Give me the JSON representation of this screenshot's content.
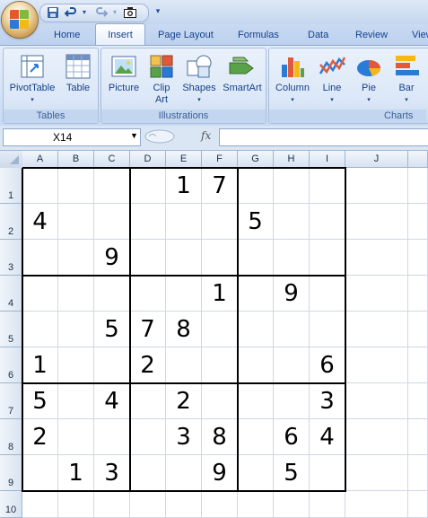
{
  "quick_access": {
    "undo_arrow": "▾",
    "redo_arrow": "▾",
    "customize_arrow": "▾"
  },
  "tabs": [
    {
      "label": "Home"
    },
    {
      "label": "Insert",
      "active": true
    },
    {
      "label": "Page Layout"
    },
    {
      "label": "Formulas"
    },
    {
      "label": "Data"
    },
    {
      "label": "Review"
    },
    {
      "label": "View"
    }
  ],
  "ribbon": {
    "groups": [
      {
        "label": "Tables",
        "buttons": [
          {
            "label": "PivotTable",
            "icon": "pivottable-icon",
            "has_dropdown": true
          },
          {
            "label": "Table",
            "icon": "table-icon"
          }
        ]
      },
      {
        "label": "Illustrations",
        "buttons": [
          {
            "label": "Picture",
            "icon": "picture-icon"
          },
          {
            "label": "Clip Art",
            "label_line1": "Clip",
            "label_line2": "Art",
            "icon": "clipart-icon"
          },
          {
            "label": "Shapes",
            "icon": "shapes-icon",
            "has_dropdown": true
          },
          {
            "label": "SmartArt",
            "icon": "smartart-icon"
          }
        ]
      },
      {
        "label": "Charts",
        "buttons": [
          {
            "label": "Column",
            "icon": "column-chart-icon",
            "has_dropdown": true
          },
          {
            "label": "Line",
            "icon": "line-chart-icon",
            "has_dropdown": true
          },
          {
            "label": "Pie",
            "icon": "pie-chart-icon",
            "has_dropdown": true
          },
          {
            "label": "Bar",
            "icon": "bar-chart-icon",
            "has_dropdown": true
          }
        ]
      }
    ],
    "dropdown_caret": "▾"
  },
  "formula_bar": {
    "name_box": "X14",
    "fx_label": "fx",
    "formula": ""
  },
  "grid": {
    "columns": [
      "A",
      "B",
      "C",
      "D",
      "E",
      "F",
      "G",
      "H",
      "I",
      "J"
    ],
    "rows": [
      "1",
      "2",
      "3",
      "4",
      "5",
      "6",
      "7",
      "8",
      "9",
      "10"
    ],
    "cells": [
      [
        "",
        "",
        "",
        "",
        "1",
        "7",
        "",
        "",
        "",
        ""
      ],
      [
        "4",
        "",
        "",
        "",
        "",
        "",
        "5",
        "",
        "",
        ""
      ],
      [
        "",
        "",
        "9",
        "",
        "",
        "",
        "",
        "",
        "",
        ""
      ],
      [
        "",
        "",
        "",
        "",
        "",
        "1",
        "",
        "9",
        "",
        ""
      ],
      [
        "",
        "",
        "5",
        "7",
        "8",
        "",
        "",
        "",
        "",
        ""
      ],
      [
        "1",
        "",
        "",
        "2",
        "",
        "",
        "",
        "",
        "6",
        ""
      ],
      [
        "5",
        "",
        "4",
        "",
        "2",
        "",
        "",
        "",
        "3",
        ""
      ],
      [
        "2",
        "",
        "",
        "",
        "3",
        "8",
        "",
        "6",
        "4",
        ""
      ],
      [
        "",
        "1",
        "3",
        "",
        "",
        "9",
        "",
        "5",
        "",
        ""
      ],
      [
        "",
        "",
        "",
        "",
        "",
        "",
        "",
        "",
        "",
        ""
      ]
    ]
  },
  "colors": {
    "sudoku_border": "#000000",
    "gridline": "#d0d7e5",
    "header_text": "#1f2f45",
    "ribbon_text": "#15428b"
  }
}
